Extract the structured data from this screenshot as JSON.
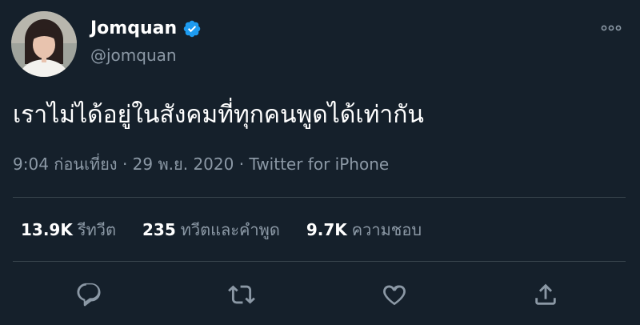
{
  "author": {
    "display_name": "Jomquan",
    "handle": "@jomquan",
    "verified": true
  },
  "tweet": {
    "text": "เราไม่ได้อยู่ในสังคมที่ทุกคนพูดได้เท่ากัน",
    "time": "9:04 ก่อนเที่ยง",
    "date": "29 พ.ย. 2020",
    "separator": "·",
    "source": "Twitter for iPhone"
  },
  "stats": {
    "retweets_count": "13.9K",
    "retweets_label": "รีทวีต",
    "quotes_count": "235",
    "quotes_label": "ทวีตและคำพูด",
    "likes_count": "9.7K",
    "likes_label": "ความชอบ"
  },
  "icons": {
    "more": "more-options-icon",
    "verified": "verified-badge-icon",
    "reply": "reply-icon",
    "retweet": "retweet-icon",
    "like": "like-icon",
    "share": "share-icon"
  },
  "colors": {
    "background": "#15202b",
    "secondary_text": "#8b98a5",
    "divider": "#38444d",
    "verified": "#1d9bf0"
  }
}
